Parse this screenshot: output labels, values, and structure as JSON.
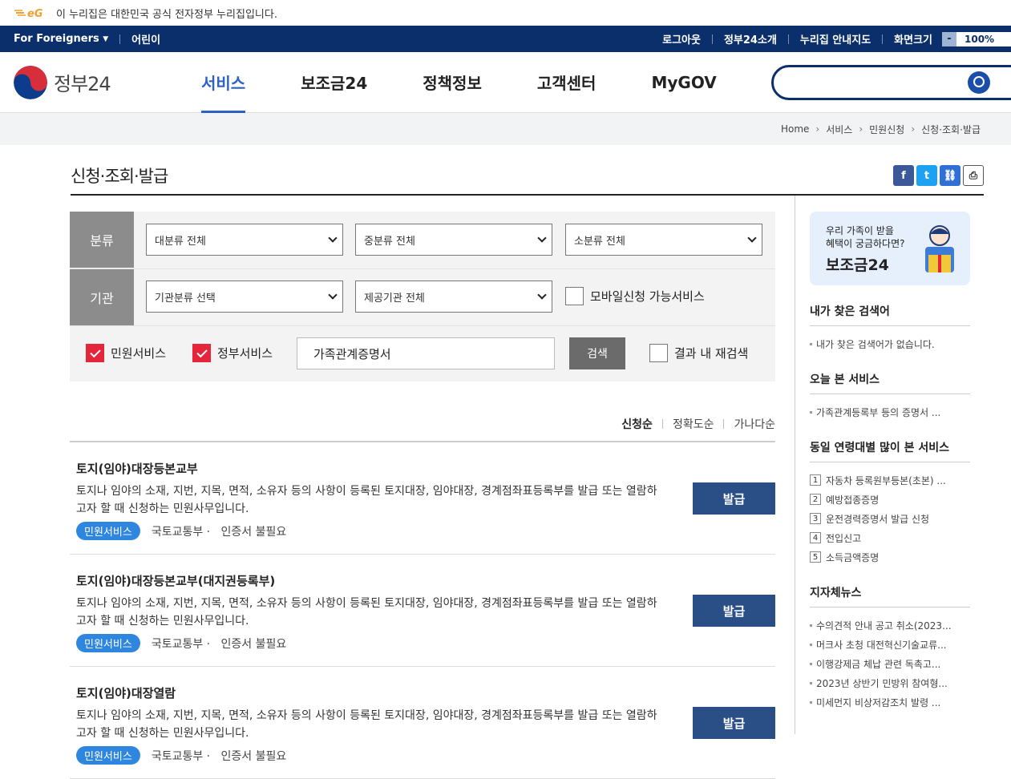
{
  "notice": {
    "text": "이 누리집은 대한민국 공식 전자정부 누리집입니다."
  },
  "util": {
    "left": [
      {
        "label": "For Foreigners"
      },
      {
        "label": "어린이"
      }
    ],
    "right": [
      {
        "label": "로그아웃"
      },
      {
        "label": "정부24소개"
      },
      {
        "label": "누리집 안내지도"
      },
      {
        "label": "화면크기"
      }
    ],
    "zoom_minus": "-",
    "zoom": "100%"
  },
  "header": {
    "logo_text": "정부24",
    "nav": [
      {
        "label": "서비스",
        "active": true
      },
      {
        "label": "보조금24"
      },
      {
        "label": "정책정보"
      },
      {
        "label": "고객센터"
      },
      {
        "label": "MyGOV"
      }
    ],
    "search_placeholder": ""
  },
  "breadcrumb": [
    "Home",
    "서비스",
    "민원신청",
    "신청·조회·발급"
  ],
  "page_title": "신청·조회·발급",
  "filter": {
    "category_label": "분류",
    "agency_label": "기관",
    "major": "대분류 전체",
    "middle": "중분류 전체",
    "minor": "소분류 전체",
    "agency_type": "기관분류 선택",
    "provider": "제공기관 전체",
    "mobile": {
      "label": "모바일신청 가능서비스",
      "checked": false
    },
    "civil": {
      "label": "민원서비스",
      "checked": true
    },
    "gov": {
      "label": "정부서비스",
      "checked": true
    },
    "keyword": "가족관계증명서",
    "search_btn": "검색",
    "research": {
      "label": "결과 내 재검색",
      "checked": false
    }
  },
  "sort": [
    "신청순",
    "정확도순",
    "가나다순"
  ],
  "results": [
    {
      "title": "토지(임야)대장등본교부",
      "desc": "토지나 임야의 소재, 지번, 지목, 면적, 소유자 등의 사항이 등록된 토지대장, 임야대장, 경계점좌표등록부를 발급 또는 열람하고자 할 때 신청하는 민원사무입니다.",
      "badge": "민원서비스",
      "agency": "국토교통부 ·",
      "cert": "인증서 불필요",
      "button": "발급"
    },
    {
      "title": "토지(임야)대장등본교부(대지권등록부)",
      "desc": "토지나 임야의 소재, 지번, 지목, 면적, 소유자 등의 사항이 등록된 토지대장, 임야대장, 경계점좌표등록부를 발급 또는 열람하고자 할 때 신청하는 민원사무입니다.",
      "badge": "민원서비스",
      "agency": "국토교통부 ·",
      "cert": "인증서 불필요",
      "button": "발급"
    },
    {
      "title": "토지(임야)대장열람",
      "desc": "토지나 임야의 소재, 지번, 지목, 면적, 소유자 등의 사항이 등록된 토지대장, 임야대장, 경계점좌표등록부를 발급 또는 열람하고자 할 때 신청하는 민원사무입니다.",
      "badge": "민원서비스",
      "agency": "국토교통부 ·",
      "cert": "인증서 불필요",
      "button": "발급"
    }
  ],
  "aside": {
    "banner_line1": "우리 가족이 받을",
    "banner_line2": "혜택이 궁금하다면?",
    "banner_title": "보조금24",
    "my_search_title": "내가 찾은 검색어",
    "my_search_empty": "내가 찾은 검색어가 없습니다.",
    "today_title": "오늘 본 서비스",
    "today_items": [
      "가족관계등록부 등의 증명서 ..."
    ],
    "age_title": "동일 연령대별 많이 본 서비스",
    "age_items": [
      {
        "n": "1",
        "label": "자동차 등록원부등본(초본) ..."
      },
      {
        "n": "2",
        "label": "예방접종증명"
      },
      {
        "n": "3",
        "label": "운전경력증명서 발급 신청"
      },
      {
        "n": "4",
        "label": "전입신고"
      },
      {
        "n": "5",
        "label": "소득금액증명"
      }
    ],
    "news_title": "지자체뉴스",
    "news_items": [
      "수의견적 안내 공고 취소(2023...",
      "머크사 초청 대전혁신기술교류...",
      "이행강제금 체납 관련 독촉고...",
      "2023년 상반기 민방위 참여형...",
      "미세먼지 비상저감조치 발령 ..."
    ]
  },
  "colors": {
    "navy": "#0b2f6a",
    "accent": "#2b62c9",
    "check": "#e4253b",
    "button": "#2a4f87",
    "badge": "#2e86de"
  }
}
